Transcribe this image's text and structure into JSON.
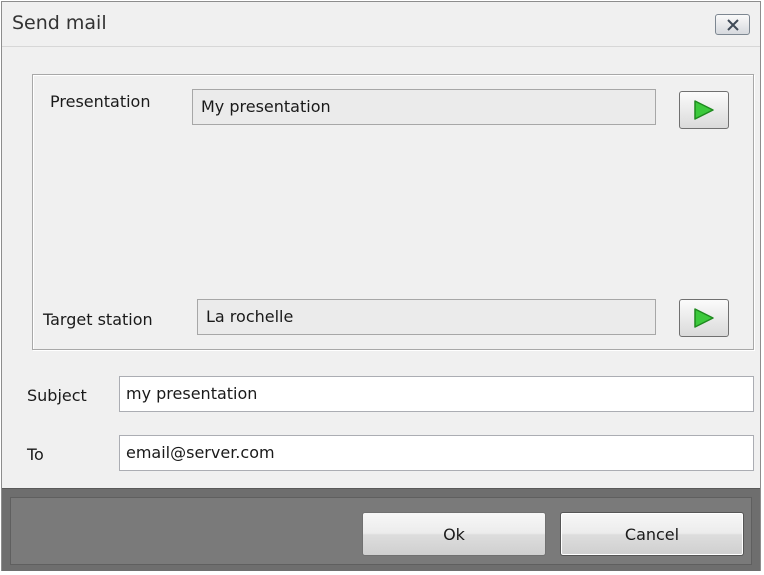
{
  "window": {
    "title": "Send mail",
    "close_icon": "close-icon"
  },
  "presentation": {
    "label": "Presentation",
    "value": "My presentation",
    "button_icon": "play-icon"
  },
  "target_station": {
    "label": "Target station",
    "value": "La rochelle",
    "button_icon": "play-icon"
  },
  "subject": {
    "label": "Subject",
    "value": "my presentation"
  },
  "to": {
    "label": "To",
    "value": "email@server.com"
  },
  "buttons": {
    "ok": "Ok",
    "cancel": "Cancel"
  },
  "colors": {
    "play_green": "#2bb52b",
    "footer_bg": "#6e6e6e"
  }
}
